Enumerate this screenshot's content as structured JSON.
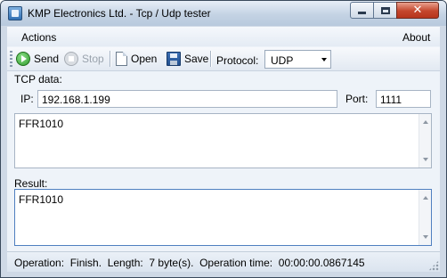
{
  "window": {
    "title": "KMP Electronics Ltd. - Tcp / Udp tester"
  },
  "menu": {
    "actions": "Actions",
    "about": "About"
  },
  "toolbar": {
    "send": "Send",
    "stop": "Stop",
    "open": "Open",
    "save": "Save",
    "protocol_label": "Protocol:",
    "protocol_value": "UDP"
  },
  "tcp": {
    "group_label": "TCP data:",
    "ip_label": "IP:",
    "ip_value": "192.168.1.199",
    "port_label": "Port:",
    "port_value": "1111",
    "data": "FFR1010"
  },
  "result": {
    "label": "Result:",
    "value": "FFR1010"
  },
  "status": {
    "text": "Operation:  Finish.  Length:  7 byte(s).  Operation time:  00:00:00.0867145"
  }
}
